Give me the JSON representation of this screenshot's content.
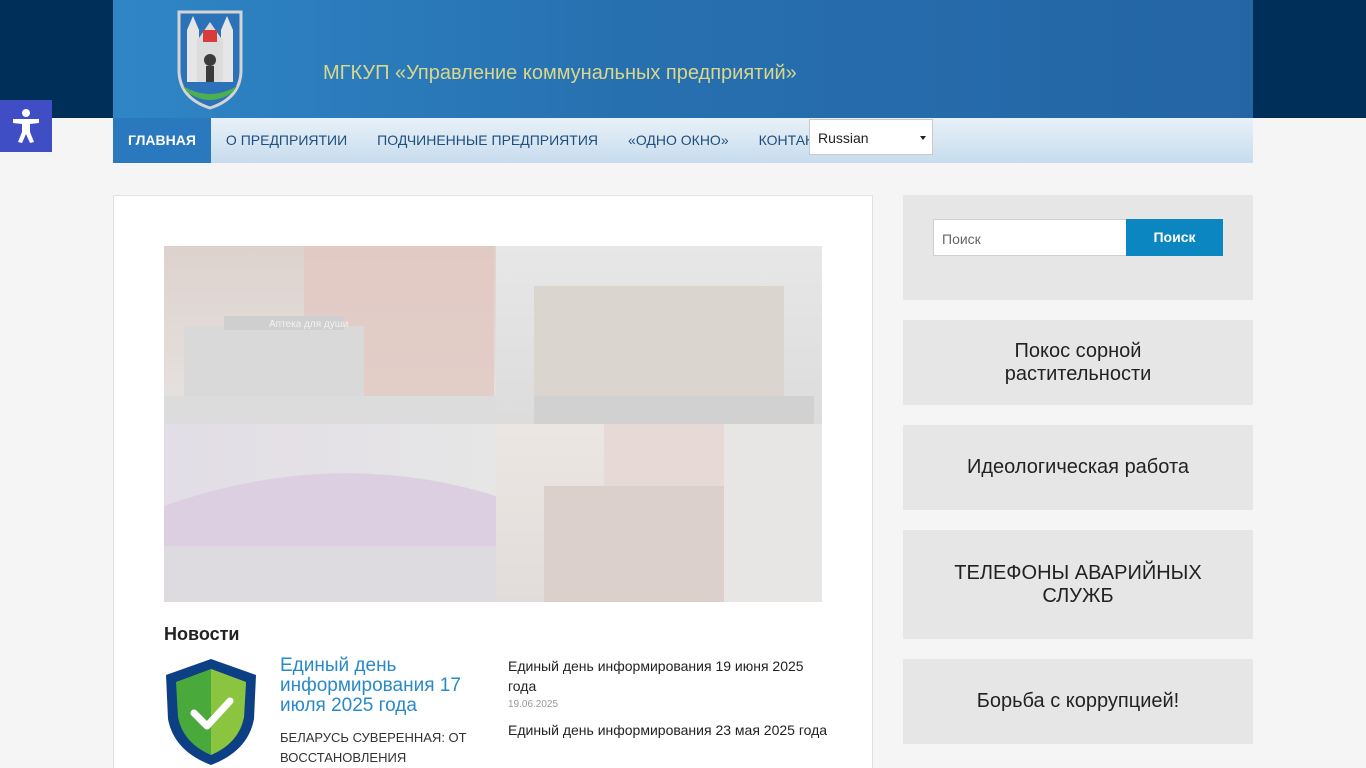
{
  "header": {
    "site_title": "МГКУП «Управление коммунальных предприятий»"
  },
  "nav": {
    "items": [
      {
        "label": "ГЛАВНАЯ",
        "active": true
      },
      {
        "label": "О ПРЕДПРИЯТИИ",
        "active": false
      },
      {
        "label": "ПОДЧИНЕННЫЕ ПРЕДПРИЯТИЯ",
        "active": false
      },
      {
        "label": "«ОДНО ОКНО»",
        "active": false
      },
      {
        "label": "КОНТАКТЫ",
        "active": false
      }
    ],
    "language": "Russian"
  },
  "slider": {
    "photo_text": "Аптека для души"
  },
  "news": {
    "heading": "Новости",
    "featured": {
      "title": "Единый день информирования 17 июля 2025 года",
      "excerpt": "БЕЛАРУСЬ СУВЕРЕННАЯ: ОТ ВОССТАНОВЛЕНИЯ"
    },
    "items": [
      {
        "title": "Единый день информирования 19 июня 2025 года",
        "date": "19.06.2025"
      },
      {
        "title": "Единый день информирования 23 мая 2025 года",
        "date": ""
      }
    ]
  },
  "sidebar": {
    "search_placeholder": "Поиск",
    "search_button": "Поиск",
    "widgets": [
      "Покос сорной растительности",
      "Идеологическая работа",
      "ТЕЛЕФОНЫ АВАРИЙНЫХ СЛУЖБ",
      "Борьба с коррупцией!"
    ]
  },
  "colors": {
    "header_blue": "#2a78be",
    "accent": "#0c86c0",
    "title_gold": "#d8d78c",
    "accessibility": "#3f4ec4"
  },
  "icons": {
    "logo": "coat-of-arms-icon",
    "accessibility": "accessibility-icon",
    "news": "shield-check-icon"
  }
}
